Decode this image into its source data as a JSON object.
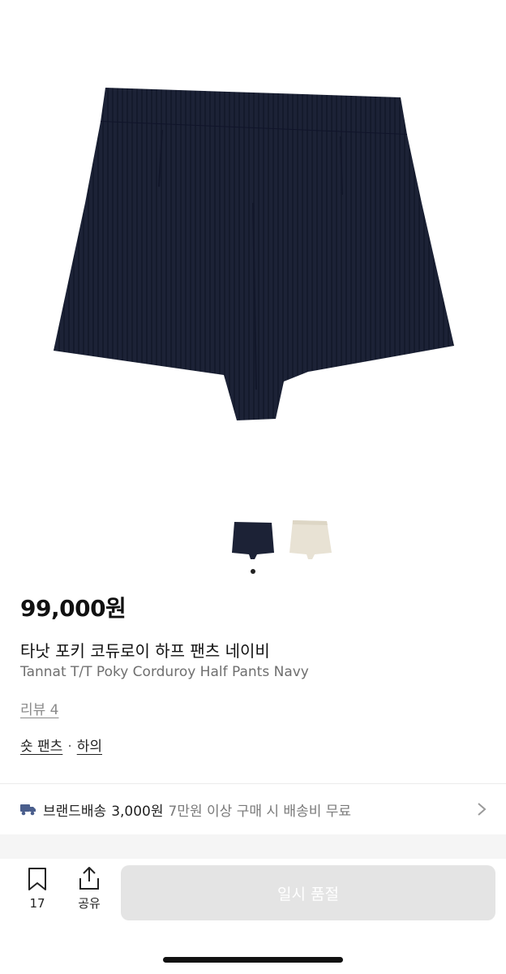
{
  "product": {
    "price": "99,000원",
    "name_ko": "타낫 포키 코듀로이 하프 팬츠 네이비",
    "name_en": "Tannat T/T Poky Corduroy Half Pants Navy",
    "review_label": "리뷰 4",
    "categories": [
      "숏 팬츠",
      "하의"
    ],
    "category_separator": "·",
    "colors": {
      "navy": "#1c2236",
      "beige": "#e8e2d4"
    }
  },
  "gallery": {
    "thumbnails": [
      "shorts-navy-thumbnail",
      "shorts-beige-thumbnail"
    ],
    "active_index": 0
  },
  "shipping": {
    "label": "브랜드배송",
    "price": "3,000원",
    "note": "7만원 이상 구매 시 배송비 무료",
    "icon": "truck-icon",
    "icon_color": "#4a5e8c"
  },
  "bottom_bar": {
    "bookmark_count": "17",
    "share_label": "공유",
    "cta_label": "일시 품절",
    "cta_color": "#e4e4e4"
  }
}
